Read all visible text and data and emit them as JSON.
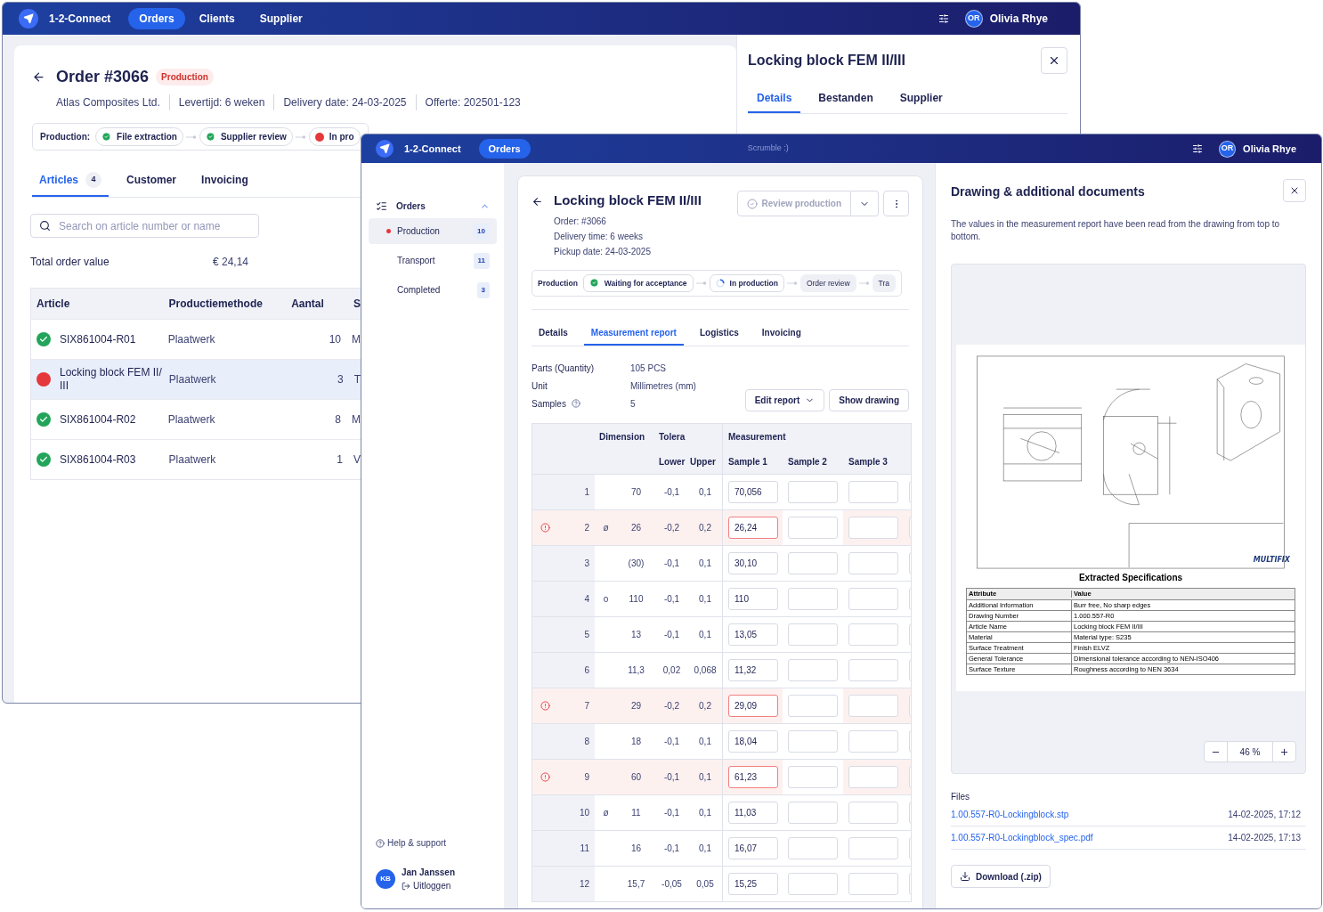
{
  "back_window": {
    "nav": {
      "brand": "1-2-Connect",
      "items": [
        {
          "label": "Orders",
          "selected": true
        },
        {
          "label": "Clients",
          "selected": false
        },
        {
          "label": "Supplier",
          "selected": false
        }
      ],
      "user": {
        "initials": "OR",
        "name": "Olivia Rhye"
      }
    },
    "order": {
      "title": "Order #3066",
      "status": "Production",
      "meta": [
        "Atlas Composites Ltd.",
        "Levertijd: 6 weken",
        "Delivery date: 24-03-2025",
        "Offerte: 202501-123"
      ],
      "steps_label": "Production:",
      "steps": [
        {
          "label": "File extraction",
          "kind": "done"
        },
        {
          "label": "Supplier review",
          "kind": "done"
        },
        {
          "label": "In pro",
          "kind": "error"
        }
      ],
      "tabs": [
        {
          "label": "Articles",
          "count": "4",
          "selected": true
        },
        {
          "label": "Customer",
          "selected": false
        },
        {
          "label": "Invoicing",
          "selected": false
        }
      ],
      "search": {
        "placeholder": "Search on article number or name"
      },
      "total": {
        "label": "Total order value",
        "value": "€ 24,14"
      },
      "table": {
        "columns": [
          "Article",
          "Productiemethode",
          "Aantal",
          "S"
        ],
        "rows": [
          {
            "kind": "ok",
            "selected": false,
            "cells": [
              "SIX861004-R01",
              "Plaatwerk",
              "10",
              "M"
            ]
          },
          {
            "kind": "error",
            "selected": true,
            "cells": [
              "Locking block FEM II/ III",
              "Plaatwerk",
              "3",
              "T"
            ]
          },
          {
            "kind": "ok",
            "selected": false,
            "cells": [
              "SIX861004-R02",
              "Plaatwerk",
              "8",
              "M"
            ]
          },
          {
            "kind": "ok",
            "selected": false,
            "cells": [
              "SIX861004-R03",
              "Plaatwerk",
              "1",
              "V"
            ]
          }
        ]
      }
    },
    "drawer": {
      "title": "Locking block FEM II/III",
      "tabs": [
        {
          "label": "Details",
          "selected": true
        },
        {
          "label": "Bestanden",
          "selected": false
        },
        {
          "label": "Supplier",
          "selected": false
        }
      ]
    }
  },
  "front_window": {
    "nav": {
      "brand": "1-2-Connect",
      "items": [
        {
          "label": "Orders",
          "selected": true
        }
      ],
      "note": "Scrumble :)",
      "user": {
        "initials": "OR",
        "name": "Olivia Rhye"
      }
    },
    "sidebar": {
      "group": {
        "label": "Orders",
        "expanded": true,
        "items": [
          {
            "label": "Production",
            "count": "10",
            "selected": true
          },
          {
            "label": "Transport",
            "count": "11",
            "selected": false
          },
          {
            "label": "Completed",
            "count": "3",
            "selected": false
          }
        ]
      },
      "help": "Help & support",
      "user": {
        "initials": "KB",
        "name": "Jan Janssen",
        "action": "Uitloggen"
      }
    },
    "detail": {
      "title": "Locking block FEM II/III",
      "meta": [
        "Order: #3066",
        "Delivery time: 6 weeks",
        "Pickup date: 24-03-2025"
      ],
      "review_button": {
        "label": "Review production",
        "disabled": true
      },
      "steps_label": "Production",
      "steps": [
        {
          "label": "Waiting for acceptance",
          "kind": "done"
        },
        {
          "label": "In production",
          "kind": "active"
        },
        {
          "label": "Order review",
          "kind": "pending"
        },
        {
          "label": "Tra",
          "kind": "pending"
        }
      ],
      "tabs": [
        {
          "label": "Details",
          "selected": false
        },
        {
          "label": "Measurement report",
          "selected": true
        },
        {
          "label": "Logistics",
          "selected": false
        },
        {
          "label": "Invoicing",
          "selected": false
        }
      ],
      "info": [
        {
          "label": "Parts (Quantity)",
          "value": "105 PCS",
          "help": false
        },
        {
          "label": "Unit",
          "value": "Millimetres (mm)",
          "help": false
        },
        {
          "label": "Samples",
          "value": "5",
          "help": true
        }
      ],
      "edit_button": "Edit report",
      "show_button": "Show drawing",
      "table": {
        "headers": {
          "dimension": "Dimension",
          "tolerance": "Tolera",
          "measurement": "Measurement",
          "lower": "Lower",
          "upper": "Upper",
          "samples": [
            "Sample 1",
            "Sample 2",
            "Sample 3"
          ]
        },
        "rows": [
          {
            "no": "1",
            "dim": "70",
            "lower": "-0,1",
            "upper": "0,1",
            "samples": [
              "70,056"
            ],
            "error": false
          },
          {
            "no": "2",
            "symbol": "ø",
            "dim": "26",
            "lower": "-0,2",
            "upper": "0,2",
            "samples": [
              "26,24"
            ],
            "error": true
          },
          {
            "no": "3",
            "dim": "(30)",
            "lower": "-0,1",
            "upper": "0,1",
            "samples": [
              "30,10"
            ],
            "error": false
          },
          {
            "no": "4",
            "symbol": "o",
            "dim": "110",
            "lower": "-0,1",
            "upper": "0,1",
            "samples": [
              "110"
            ],
            "error": false
          },
          {
            "no": "5",
            "dim": "13",
            "lower": "-0,1",
            "upper": "0,1",
            "samples": [
              "13,05"
            ],
            "error": false
          },
          {
            "no": "6",
            "dim": "11,3",
            "lower": "0,02",
            "upper": "0,068",
            "samples": [
              "11,32"
            ],
            "error": false
          },
          {
            "no": "7",
            "dim": "29",
            "lower": "-0,2",
            "upper": "0,2",
            "samples": [
              "29,09"
            ],
            "error": true
          },
          {
            "no": "8",
            "dim": "18",
            "lower": "-0,1",
            "upper": "0,1",
            "samples": [
              "18,04"
            ],
            "error": false
          },
          {
            "no": "9",
            "dim": "60",
            "lower": "-0,1",
            "upper": "0,1",
            "samples": [
              "61,23"
            ],
            "error": true
          },
          {
            "no": "10",
            "symbol": "ø",
            "dim": "11",
            "lower": "-0,1",
            "upper": "0,1",
            "samples": [
              "11,03"
            ],
            "error": false
          },
          {
            "no": "11",
            "dim": "16",
            "lower": "-0,1",
            "upper": "0,1",
            "samples": [
              "16,07"
            ],
            "error": false
          },
          {
            "no": "12",
            "dim": "15,7",
            "lower": "-0,05",
            "upper": "0,05",
            "samples": [
              "15,25"
            ],
            "error": false
          }
        ]
      }
    },
    "documents": {
      "title": "Drawing & additional documents",
      "description": "The values in the measurement report have been read from the drawing from top to bottom.",
      "drawing": {
        "logo": "MULTIFIX",
        "spec_title": "Extracted Specifications",
        "spec_columns": [
          "Attribute",
          "Value"
        ],
        "spec_rows": [
          [
            "Additional Information",
            "Burr free, No sharp edges"
          ],
          [
            "Drawing Number",
            "1.000.557-R0"
          ],
          [
            "Article Name",
            "Locking block FEM II/III"
          ],
          [
            "Material",
            "Material type: S235"
          ],
          [
            "Surface Treatment",
            "Finish ELVZ"
          ],
          [
            "General Tolerance",
            "Dimensional tolerance according to NEN-ISO406"
          ],
          [
            "Surface Texture",
            "Roughness according to NEN 3634"
          ]
        ]
      },
      "zoom": "46 %",
      "files_label": "Files",
      "files": [
        {
          "name": "1.00.557-R0-Lockingblock.stp",
          "date": "14-02-2025, 17:12"
        },
        {
          "name": "1.00.557-R0-Lockingblock_spec.pdf",
          "date": "14-02-2025, 17:13"
        }
      ],
      "download": "Download (.zip)"
    }
  }
}
